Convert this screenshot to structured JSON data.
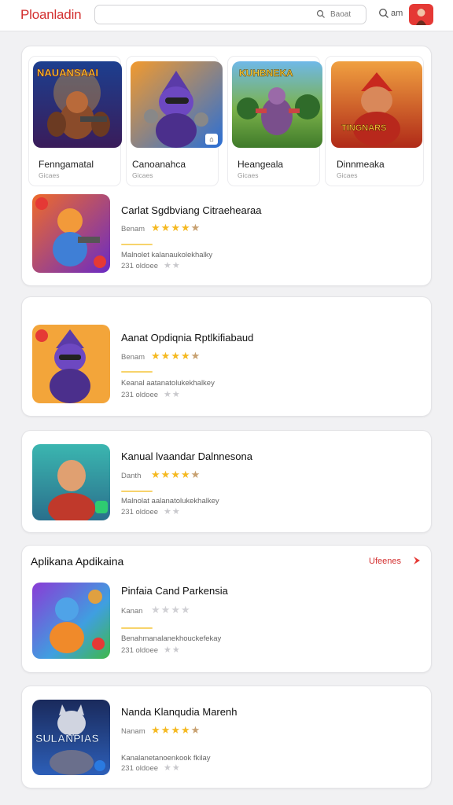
{
  "header": {
    "logo": "Ploanladin",
    "search_placeholder": "",
    "search_button": "Baoat",
    "action_label": "am",
    "icons": [
      "search-icon",
      "search-icon",
      "avatar"
    ]
  },
  "featured": {
    "items": [
      {
        "badge": "NAUANSAAI",
        "name": "Fenngamatal",
        "sub": "Gicaes"
      },
      {
        "badge": "",
        "name": "Canoanahca",
        "sub": "Gicaes"
      },
      {
        "badge": "KUHBNEKA",
        "name": "Heangeala",
        "sub": "Gicaes"
      },
      {
        "badge": "TINGNARS",
        "name": "Dinnmeaka",
        "sub": "Gicaes"
      }
    ]
  },
  "rows": [
    {
      "title": "Carlat Sgdbviang Citraehearaa",
      "meta": "Benam",
      "stars": 4,
      "desc": "Malnolet kalanaukolekhalky",
      "downloads": "231 oldoee"
    },
    {
      "title": "Aanat Opdiqnia Rptlkifiabaud",
      "meta": "Benam",
      "stars": 4,
      "desc": "Keanal aatanatolukekhalkey",
      "downloads": "231 oldoee"
    },
    {
      "title": "Kanual lvaandar Dalnnesona",
      "meta": "Danth",
      "stars": 4,
      "desc": "Malnolat aalanatolukekhalkey",
      "downloads": "231 oldoee"
    }
  ],
  "section": {
    "title": "Aplikana Apdikaina",
    "link": "Ufeenes",
    "rows": [
      {
        "title": "Pinfaia Cand Parkensia",
        "meta": "Kanan",
        "stars": 0,
        "desc": "Benahmanalanekhouckefekay",
        "downloads": "231 oldoee"
      },
      {
        "title": "Nanda Klanqudia Marenh",
        "meta": "Nanam",
        "stars": 4,
        "desc": "Kanalanetanoenkook fkilay",
        "downloads": "231 oldoee",
        "thumb_badge": "SULANPIAS"
      }
    ]
  },
  "colors": {
    "accent": "#d32f2f",
    "star": "#f5b921",
    "star_off": "#d0d0d4"
  }
}
